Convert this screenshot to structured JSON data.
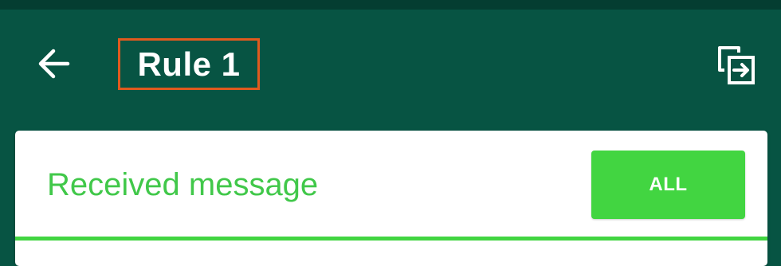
{
  "app_bar": {
    "title": "Rule 1",
    "back_icon": "arrow-left-icon",
    "action_icon": "switch-screen-icon"
  },
  "card": {
    "label": "Received message",
    "button_label": "ALL"
  },
  "colors": {
    "app_bar_bg": "#075443",
    "status_bar_bg": "#043d31",
    "accent_green": "#42d541",
    "label_green": "#41c84a",
    "highlight_outline": "#e05a1e",
    "card_bg": "#ffffff"
  }
}
